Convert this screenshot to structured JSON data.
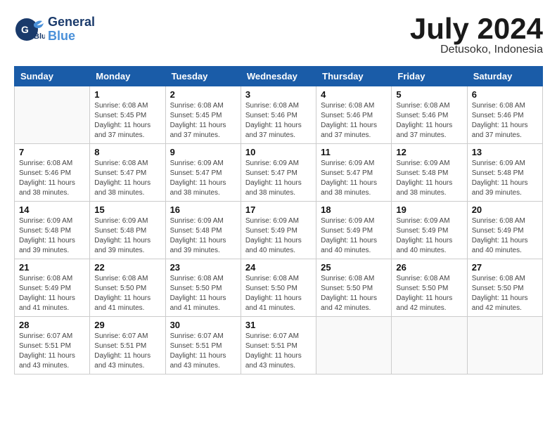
{
  "logo": {
    "line1": "General",
    "line2": "Blue"
  },
  "title": "July 2024",
  "location": "Detusoko, Indonesia",
  "weekdays": [
    "Sunday",
    "Monday",
    "Tuesday",
    "Wednesday",
    "Thursday",
    "Friday",
    "Saturday"
  ],
  "weeks": [
    [
      {
        "day": "",
        "info": ""
      },
      {
        "day": "1",
        "info": "Sunrise: 6:08 AM\nSunset: 5:45 PM\nDaylight: 11 hours\nand 37 minutes."
      },
      {
        "day": "2",
        "info": "Sunrise: 6:08 AM\nSunset: 5:45 PM\nDaylight: 11 hours\nand 37 minutes."
      },
      {
        "day": "3",
        "info": "Sunrise: 6:08 AM\nSunset: 5:46 PM\nDaylight: 11 hours\nand 37 minutes."
      },
      {
        "day": "4",
        "info": "Sunrise: 6:08 AM\nSunset: 5:46 PM\nDaylight: 11 hours\nand 37 minutes."
      },
      {
        "day": "5",
        "info": "Sunrise: 6:08 AM\nSunset: 5:46 PM\nDaylight: 11 hours\nand 37 minutes."
      },
      {
        "day": "6",
        "info": "Sunrise: 6:08 AM\nSunset: 5:46 PM\nDaylight: 11 hours\nand 37 minutes."
      }
    ],
    [
      {
        "day": "7",
        "info": "Sunrise: 6:08 AM\nSunset: 5:46 PM\nDaylight: 11 hours\nand 38 minutes."
      },
      {
        "day": "8",
        "info": "Sunrise: 6:08 AM\nSunset: 5:47 PM\nDaylight: 11 hours\nand 38 minutes."
      },
      {
        "day": "9",
        "info": "Sunrise: 6:09 AM\nSunset: 5:47 PM\nDaylight: 11 hours\nand 38 minutes."
      },
      {
        "day": "10",
        "info": "Sunrise: 6:09 AM\nSunset: 5:47 PM\nDaylight: 11 hours\nand 38 minutes."
      },
      {
        "day": "11",
        "info": "Sunrise: 6:09 AM\nSunset: 5:47 PM\nDaylight: 11 hours\nand 38 minutes."
      },
      {
        "day": "12",
        "info": "Sunrise: 6:09 AM\nSunset: 5:48 PM\nDaylight: 11 hours\nand 38 minutes."
      },
      {
        "day": "13",
        "info": "Sunrise: 6:09 AM\nSunset: 5:48 PM\nDaylight: 11 hours\nand 39 minutes."
      }
    ],
    [
      {
        "day": "14",
        "info": "Sunrise: 6:09 AM\nSunset: 5:48 PM\nDaylight: 11 hours\nand 39 minutes."
      },
      {
        "day": "15",
        "info": "Sunrise: 6:09 AM\nSunset: 5:48 PM\nDaylight: 11 hours\nand 39 minutes."
      },
      {
        "day": "16",
        "info": "Sunrise: 6:09 AM\nSunset: 5:48 PM\nDaylight: 11 hours\nand 39 minutes."
      },
      {
        "day": "17",
        "info": "Sunrise: 6:09 AM\nSunset: 5:49 PM\nDaylight: 11 hours\nand 40 minutes."
      },
      {
        "day": "18",
        "info": "Sunrise: 6:09 AM\nSunset: 5:49 PM\nDaylight: 11 hours\nand 40 minutes."
      },
      {
        "day": "19",
        "info": "Sunrise: 6:09 AM\nSunset: 5:49 PM\nDaylight: 11 hours\nand 40 minutes."
      },
      {
        "day": "20",
        "info": "Sunrise: 6:08 AM\nSunset: 5:49 PM\nDaylight: 11 hours\nand 40 minutes."
      }
    ],
    [
      {
        "day": "21",
        "info": "Sunrise: 6:08 AM\nSunset: 5:49 PM\nDaylight: 11 hours\nand 41 minutes."
      },
      {
        "day": "22",
        "info": "Sunrise: 6:08 AM\nSunset: 5:50 PM\nDaylight: 11 hours\nand 41 minutes."
      },
      {
        "day": "23",
        "info": "Sunrise: 6:08 AM\nSunset: 5:50 PM\nDaylight: 11 hours\nand 41 minutes."
      },
      {
        "day": "24",
        "info": "Sunrise: 6:08 AM\nSunset: 5:50 PM\nDaylight: 11 hours\nand 41 minutes."
      },
      {
        "day": "25",
        "info": "Sunrise: 6:08 AM\nSunset: 5:50 PM\nDaylight: 11 hours\nand 42 minutes."
      },
      {
        "day": "26",
        "info": "Sunrise: 6:08 AM\nSunset: 5:50 PM\nDaylight: 11 hours\nand 42 minutes."
      },
      {
        "day": "27",
        "info": "Sunrise: 6:08 AM\nSunset: 5:50 PM\nDaylight: 11 hours\nand 42 minutes."
      }
    ],
    [
      {
        "day": "28",
        "info": "Sunrise: 6:07 AM\nSunset: 5:51 PM\nDaylight: 11 hours\nand 43 minutes."
      },
      {
        "day": "29",
        "info": "Sunrise: 6:07 AM\nSunset: 5:51 PM\nDaylight: 11 hours\nand 43 minutes."
      },
      {
        "day": "30",
        "info": "Sunrise: 6:07 AM\nSunset: 5:51 PM\nDaylight: 11 hours\nand 43 minutes."
      },
      {
        "day": "31",
        "info": "Sunrise: 6:07 AM\nSunset: 5:51 PM\nDaylight: 11 hours\nand 43 minutes."
      },
      {
        "day": "",
        "info": ""
      },
      {
        "day": "",
        "info": ""
      },
      {
        "day": "",
        "info": ""
      }
    ]
  ]
}
